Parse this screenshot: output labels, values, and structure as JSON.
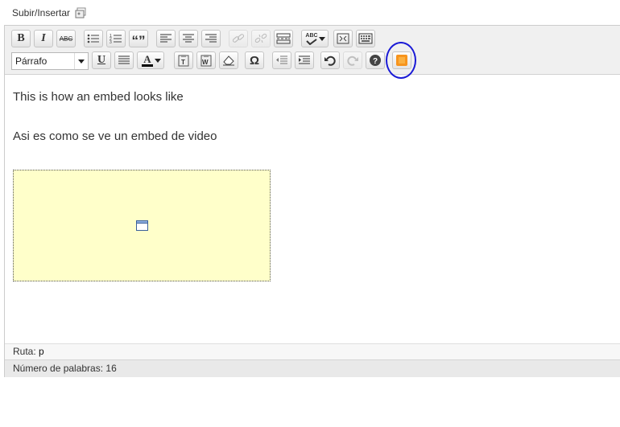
{
  "upload": {
    "label": "Subir/Insertar"
  },
  "toolbar": {
    "format_select": "Párrafo",
    "buttons": {
      "bold": "B",
      "italic": "I",
      "strike": "ABC",
      "blockquote": "“”",
      "underline": "U",
      "special_chars": "Ω",
      "spellcheck": "ABC"
    },
    "colors": {
      "plugin_accent": "#f7941d",
      "highlight_ring": "#1a1ad6"
    }
  },
  "content": {
    "paragraphs": [
      "This is how an embed looks like",
      "Asi es como se ve un embed de video"
    ],
    "embed": {
      "background": "#ffffca"
    }
  },
  "status": {
    "path_label": "Ruta:",
    "path_value": "p",
    "word_count_label": "Número de palabras: 16"
  }
}
